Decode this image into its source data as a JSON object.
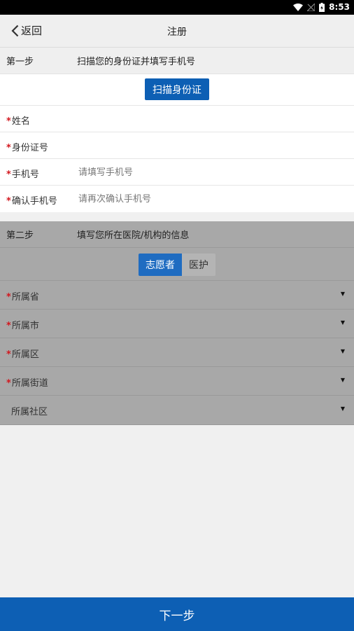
{
  "status": {
    "time": "8:53"
  },
  "nav": {
    "back_label": "返回",
    "title": "注册"
  },
  "step1": {
    "step_label": "第一步",
    "desc": "扫描您的身份证并填写手机号",
    "scan_button": "扫描身份证",
    "fields": [
      {
        "label": "姓名",
        "value": "",
        "placeholder": ""
      },
      {
        "label": "身份证号",
        "value": "",
        "placeholder": ""
      },
      {
        "label": "手机号",
        "value": "",
        "placeholder": "请填写手机号"
      },
      {
        "label": "确认手机号",
        "value": "",
        "placeholder": "请再次确认手机号"
      }
    ]
  },
  "step2": {
    "step_label": "第二步",
    "desc": "填写您所在医院/机构的信息",
    "toggle": {
      "selected": "志愿者",
      "other": "医护"
    },
    "selects": [
      {
        "label": "所属省",
        "required": true
      },
      {
        "label": "所属市",
        "required": true
      },
      {
        "label": "所属区",
        "required": true
      },
      {
        "label": "所属街道",
        "required": true
      },
      {
        "label": "所属社区",
        "required": false
      }
    ],
    "required_mark": "*",
    "caret": "▼"
  },
  "footer": {
    "next_button": "下一步"
  },
  "colors": {
    "primary": "#0d5fb4",
    "required": "#d3171e",
    "disabled_bg": "#a8a8a8"
  }
}
